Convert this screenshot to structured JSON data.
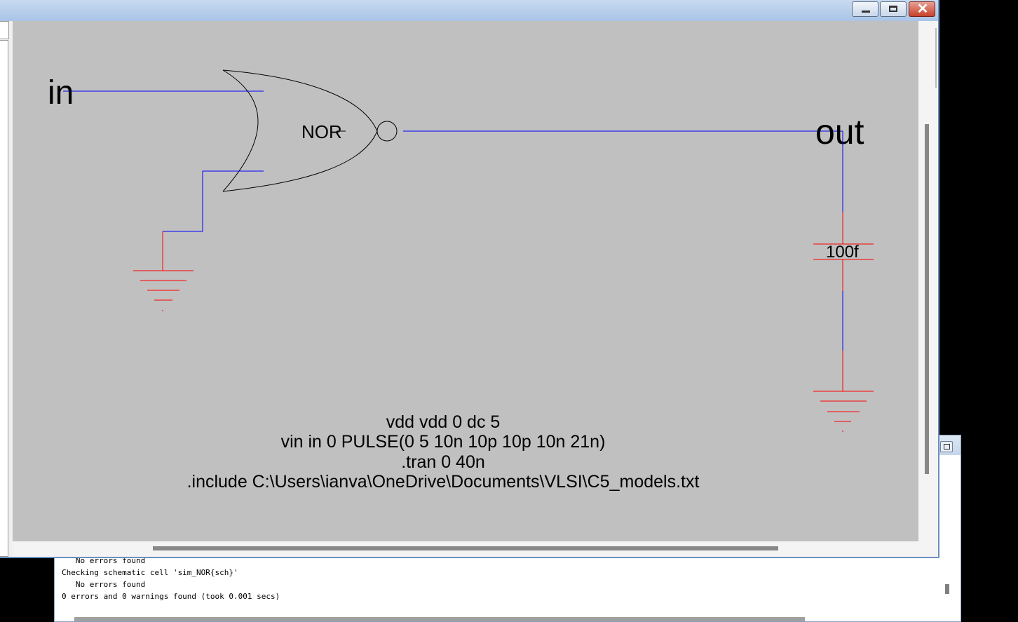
{
  "colors": {
    "wire": "#0000ff",
    "component": "#ff0000",
    "canvas": "#c0c0c0",
    "gate": "#000000"
  },
  "schematic": {
    "input_label": "in",
    "output_label": "out",
    "gate_label": "NOR",
    "capacitor_value": "100f"
  },
  "spice": {
    "lines": [
      "vdd vdd 0 dc 5",
      "vin in 0 PULSE(0 5 10n 10p 10p 10n 21n)",
      ".tran 0 40n",
      ".include C:\\Users\\ianva\\OneDrive\\Documents\\VLSI\\C5_models.txt"
    ]
  },
  "messages": {
    "lines": [
      "   No errors found",
      "Checking schematic cell 'sim_NOR{sch}'",
      "   No errors found",
      "0 errors and 0 warnings found (took 0.001 secs)"
    ]
  },
  "icons": {
    "minimize": "minimize-icon",
    "maximize": "maximize-icon",
    "close": "close-icon"
  },
  "window_controls": {
    "close_glyph": "✕"
  }
}
